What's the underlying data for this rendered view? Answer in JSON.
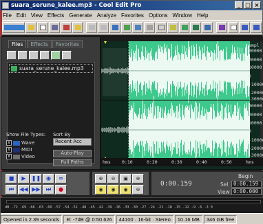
{
  "window": {
    "title": "suara_serune_kalee.mp3 - Cool Edit Pro"
  },
  "menu": [
    "File",
    "Edit",
    "View",
    "Effects",
    "Generate",
    "Analyze",
    "Favorites",
    "Options",
    "Window",
    "Help"
  ],
  "organizer": {
    "tabs": [
      "Files",
      "Effects",
      "Favorites"
    ],
    "file": "suara_serune_kalee.mp3",
    "show_types_label": "Show File Types:",
    "types": [
      "Wave",
      "MIDI",
      "Video"
    ],
    "sort_label": "Sort By",
    "sort_value": "Recent Acc",
    "auto_play": "Auto-Play",
    "full_paths": "Full Paths"
  },
  "waveform": {
    "time_ticks": [
      "hms",
      "0:10",
      "0:20",
      "0:30",
      "0:40",
      "0:50",
      "hms"
    ],
    "amp_ticks_top": [
      "smpl",
      "30000",
      "20000",
      "10000",
      "0",
      "-10000",
      "-20000",
      "-30000"
    ],
    "amp_ticks_bottom": [
      "smpl",
      "30000",
      "20000",
      "10000",
      "0",
      "-10000",
      "-20000",
      "-30000",
      "smpl"
    ],
    "colors": {
      "selection_bg": "#3ec98c",
      "wave": "#ffffff",
      "unselected_bg": "#0f2a1e"
    }
  },
  "time": {
    "current": "0:00.159",
    "begin_label": "Begin",
    "sel_label": "Sel",
    "view_label": "View",
    "sel_begin": "0:00.159",
    "view_begin": "0:00.000"
  },
  "meter_scale": "dB -72 -69 -66 -63 -60 -57 -54 -51 -48 -45 -42 -39 -36 -33 -30 -27 -24 -21 -18 -15 -12 -9 -6 -3 0",
  "status": {
    "opened": "Opened in 2.39 seconds",
    "cursor": "R: -7dB @ 0:50.626",
    "format": "44100 · 16-bit · Stereo",
    "size": "10.16 MB",
    "free": "346 GB free"
  }
}
